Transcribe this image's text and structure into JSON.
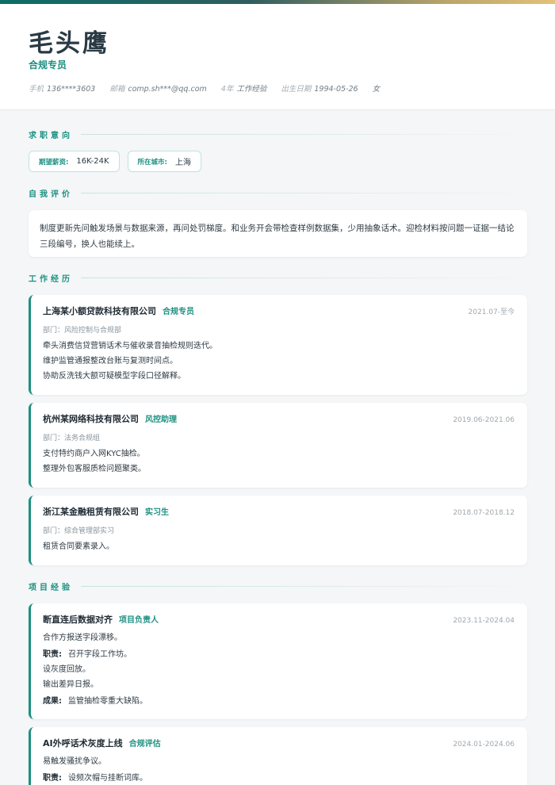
{
  "header": {
    "name": "毛头鹰",
    "title": "合规专员",
    "meta": [
      {
        "key": "手机",
        "value": "136****3603"
      },
      {
        "key": "邮箱",
        "value": "comp.sh***@qq.com"
      },
      {
        "key": "4年",
        "value": "工作经验"
      },
      {
        "key": "出生日期",
        "value": "1994-05-26"
      },
      {
        "key": "",
        "value": "女"
      }
    ]
  },
  "sections": {
    "intent": "求职意向",
    "summary": "自我评价",
    "work": "工作经历",
    "projects": "项目经验"
  },
  "intent": {
    "salary_label": "期望薪资:",
    "salary_value": "16K-24K",
    "city_label": "所在城市:",
    "city_value": "上海"
  },
  "summary": "制度更新先问触发场景与数据来源，再问处罚梯度。和业务开会带检查样例数据集，少用抽象话术。迎检材料按问题一证据一结论三段编号，换人也能续上。",
  "work": [
    {
      "company": "上海某小额贷款科技有限公司",
      "role": "合规专员",
      "date": "2021.07-至今",
      "dept": "部门：风险控制与合规部",
      "lines": [
        "牵头消费信贷营销话术与催收录音抽检规则迭代。",
        "维护监管通报整改台账与复测时间点。",
        "协助反洗钱大额可疑模型字段口径解释。"
      ]
    },
    {
      "company": "杭州某网络科技有限公司",
      "role": "风控助理",
      "date": "2019.06-2021.06",
      "dept": "部门：法务合规组",
      "lines": [
        "支付特约商户入网KYC抽检。",
        "整理外包客服质检问题聚类。"
      ]
    },
    {
      "company": "浙江某金融租赁有限公司",
      "role": "实习生",
      "date": "2018.07-2018.12",
      "dept": "部门：综合管理部实习",
      "lines": [
        "租赁合同要素录入。"
      ]
    }
  ],
  "projects": [
    {
      "name": "断直连后数据对齐",
      "role": "项目负责人",
      "date": "2023.11-2024.04",
      "desc": "合作方报送字段漂移。",
      "duty_label": "职责:",
      "duty_first": "召开字段工作坊。",
      "duty_rest": [
        "设灰度回放。",
        "输出差异日报。"
      ],
      "result_label": "成果:",
      "result": "监管抽检零重大缺陷。"
    },
    {
      "name": "AI外呼话术灰度上线",
      "role": "合规评估",
      "date": "2024.01-2024.06",
      "desc": "易触发骚扰争议。",
      "duty_label": "职责:",
      "duty_first": "设频次帽与挂断词库。"
    }
  ]
}
